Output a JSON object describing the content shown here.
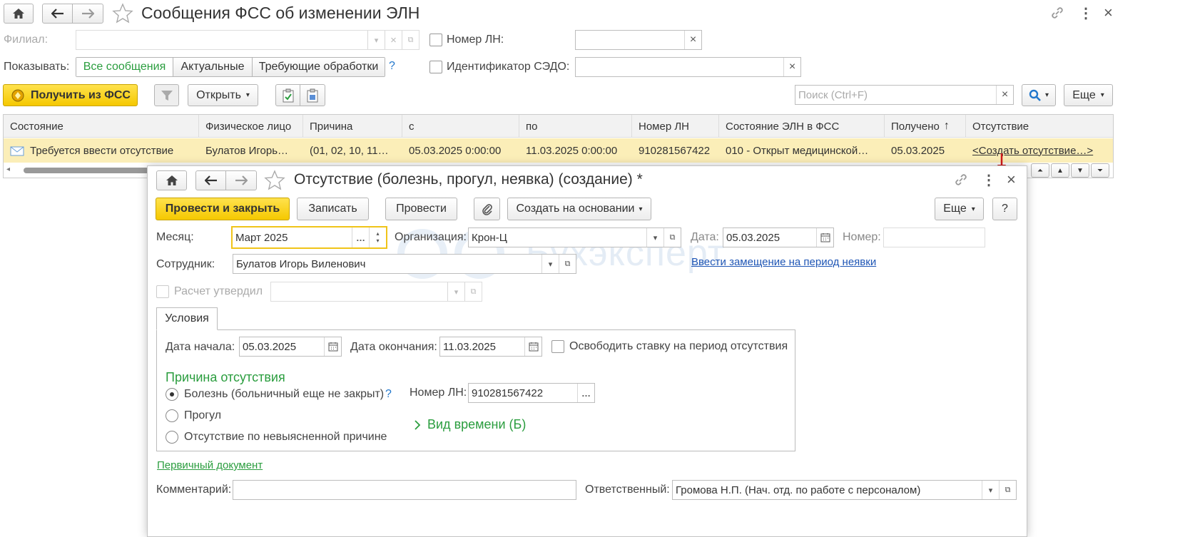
{
  "main": {
    "title": "Сообщения ФСС об изменении ЭЛН",
    "filial_label": "Филиал:",
    "nomer_ln_label": "Номер ЛН:",
    "show_label": "Показывать:",
    "filter_tabs": [
      "Все сообщения",
      "Актуальные",
      "Требующие обработки"
    ],
    "help": "?",
    "sedo_label": "Идентификатор СЭДО:",
    "get_fss_button": "Получить из ФСС",
    "open_button": "Открыть",
    "search_placeholder": "Поиск (Ctrl+F)",
    "more_button": "Еще",
    "table": {
      "columns": [
        "Состояние",
        "Физическое лицо",
        "Причина",
        "с",
        "по",
        "Номер ЛН",
        "Состояние ЭЛН в ФСС",
        "Получено",
        "Отсутствие"
      ],
      "row": [
        "Требуется ввести отсутствие",
        "Булатов Игорь…",
        "(01, 02, 10, 11…",
        "05.03.2025 0:00:00",
        "11.03.2025 0:00:00",
        "910281567422",
        "010 - Открыт медицинской…",
        "05.03.2025",
        "<Создать отсутствие…>"
      ]
    }
  },
  "dialog": {
    "title": "Отсутствие (болезнь, прогул, неявка) (создание) *",
    "post_close_button": "Провести и закрыть",
    "save_button": "Записать",
    "post_button": "Провести",
    "create_based_button": "Создать на основании",
    "more_button": "Еще",
    "help_button": "?",
    "month_label": "Месяц:",
    "month_value": "Март 2025",
    "org_label": "Организация:",
    "org_value": "Крон-Ц",
    "date_label": "Дата:",
    "date_value": "05.03.2025",
    "number_label": "Номер:",
    "number_value": "",
    "employee_label": "Сотрудник:",
    "employee_value": "Булатов Игорь Виленович",
    "substitute_link": "Ввести замещение на период неявки",
    "approved_label": "Расчет утвердил",
    "watermark": "Бухэксперт",
    "tab_label": "Условия",
    "start_label": "Дата начала:",
    "start_value": "05.03.2025",
    "end_label": "Дата окончания:",
    "end_value": "11.03.2025",
    "free_rate_label": "Освободить ставку на период отсутствия",
    "reason_title": "Причина отсутствия",
    "reasons": [
      "Болезнь (больничный еще не закрыт)",
      "Прогул",
      "Отсутствие по невыясненной причине"
    ],
    "reason_help": "?",
    "ln_label": "Номер ЛН:",
    "ln_value": "910281567422",
    "time_kind": "Вид времени (Б)",
    "primary_doc_link": "Первичный документ",
    "comment_label": "Комментарий:",
    "comment_value": "",
    "responsible_label": "Ответственный:",
    "responsible_value": "Громова Н.П. (Нач. отд. по работе с персоналом)"
  }
}
